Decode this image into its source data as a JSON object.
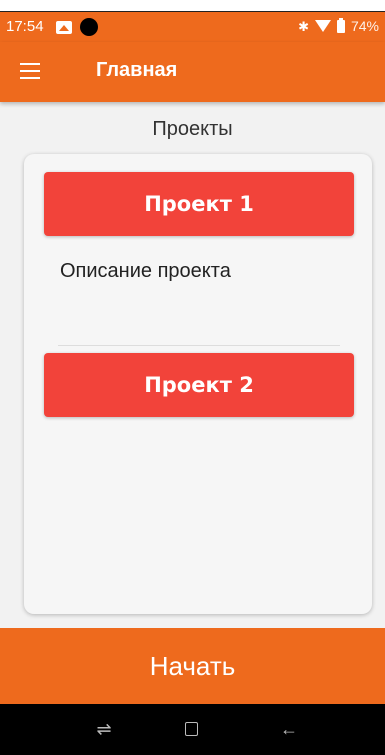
{
  "status_bar": {
    "time": "17:54",
    "battery_text": "74%",
    "icons": {
      "gallery": "gallery-icon",
      "recording": "record-dot-icon",
      "bluetooth": "bluetooth-icon",
      "wifi": "wifi-icon",
      "battery": "battery-icon"
    }
  },
  "app_bar": {
    "title": "Главная",
    "menu_icon": "hamburger-menu-icon"
  },
  "main": {
    "section_title": "Проекты",
    "projects": [
      {
        "label": "Проект 1",
        "description": "Описание проекта"
      },
      {
        "label": "Проект 2"
      }
    ]
  },
  "footer": {
    "start_label": "Начать"
  },
  "nav_bar": {
    "recent_glyph": "⇌",
    "back_glyph": "←",
    "icons": [
      "recent-apps-icon",
      "home-icon",
      "back-icon"
    ]
  },
  "colors": {
    "accent": "#ee6a1d",
    "project_button": "#f2433a",
    "background": "#f2f2f2"
  }
}
